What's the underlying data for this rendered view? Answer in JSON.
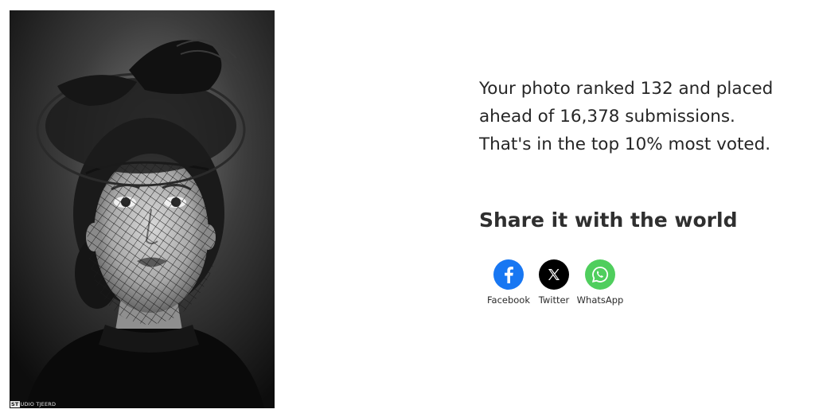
{
  "photo": {
    "watermark_mark": "ST",
    "watermark_text": "UDIO TJEERD"
  },
  "result": {
    "line1": "Your photo ranked 132 and placed",
    "line2": "ahead of 16,378 submissions.",
    "line3": "That's in the top 10% most voted."
  },
  "share": {
    "heading": "Share it with the world",
    "buttons": [
      {
        "label": "Facebook",
        "icon": "facebook-icon",
        "color": "#1877f2"
      },
      {
        "label": "Twitter",
        "icon": "x-twitter-icon",
        "color": "#000000"
      },
      {
        "label": "WhatsApp",
        "icon": "whatsapp-icon",
        "color": "#4fce5d"
      }
    ]
  }
}
